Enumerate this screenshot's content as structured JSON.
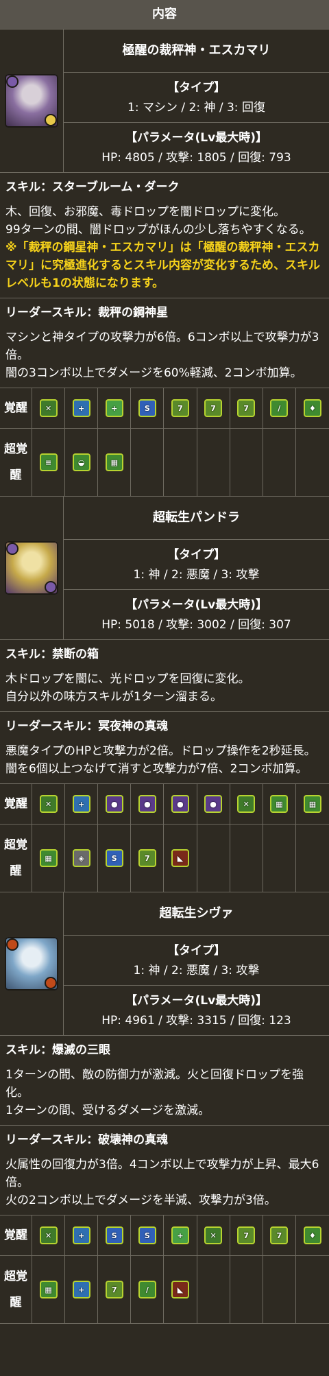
{
  "header": {
    "title": "内容"
  },
  "cards": [
    {
      "name": "極醒の裁秤神・エスカマリ",
      "portrait_colors": [
        "#8a6fa0",
        "#d8d0d8",
        "#3a2a46"
      ],
      "badge_colors": [
        "#7a5aa8",
        "#e7c84a"
      ],
      "type_label": "【タイプ】",
      "type_value": "1: マシン / 2: 神 / 3: 回復",
      "param_label": "【パラメータ(Lv最大時)】",
      "param_value": "HP: 4805 / 攻撃: 1805 / 回復: 793",
      "skill_title": "スキル：スターブルーム・ダーク",
      "skill_lines": [
        "木、回復、お邪魔、毒ドロップを闇ドロップに変化。",
        "99ターンの間、闇ドロップがほんの少し落ちやすくなる。"
      ],
      "skill_warn": "※「裁秤の鋼星神・エスカマリ」は「極醒の裁秤神・エスカマリ」に究極進化するとスキル内容が変化するため、スキルレベルも1の状態になります。",
      "leader_title": "リーダースキル：裁秤の鋼神星",
      "leader_lines": [
        "マシンと神タイプの攻撃力が6倍。6コンボ以上で攻撃力が3倍。",
        "闇の3コンボ以上でダメージを60%軽減、2コンボ加算。"
      ],
      "awaken_label": "覚醒",
      "awakenings": [
        {
          "icon": "cross-swords-icon",
          "glyph": "✕",
          "bg": "#3f7a2a"
        },
        {
          "icon": "plus-drop-icon",
          "glyph": "+",
          "bg": "#2f6fb0"
        },
        {
          "icon": "drop-enhance-icon",
          "glyph": "+",
          "bg": "#47a045"
        },
        {
          "icon": "bind-resist-icon",
          "glyph": "S",
          "bg": "#3060b8"
        },
        {
          "icon": "seven-combo-icon",
          "glyph": "7",
          "bg": "#5a8a2a"
        },
        {
          "icon": "seven-combo-icon",
          "glyph": "7",
          "bg": "#5a8a2a"
        },
        {
          "icon": "seven-combo-icon",
          "glyph": "7",
          "bg": "#5a8a2a"
        },
        {
          "icon": "wand-icon",
          "glyph": "/",
          "bg": "#3f8a30"
        },
        {
          "icon": "gem-wand-icon",
          "glyph": "♦",
          "bg": "#3f8a30"
        }
      ],
      "super_label_1": "超覚",
      "super_label_2": "醒",
      "super_awakenings": [
        {
          "icon": "scroll-icon",
          "glyph": "≡",
          "bg": "#3f8a30"
        },
        {
          "icon": "bowl-icon",
          "glyph": "◒",
          "bg": "#3f8a30"
        },
        {
          "icon": "jammer-grid-icon",
          "glyph": "▦",
          "bg": "#3f8a30"
        }
      ]
    },
    {
      "name": "超転生パンドラ",
      "portrait_colors": [
        "#c6a94a",
        "#efe1a4",
        "#4a2f6e"
      ],
      "badge_colors": [
        "#7a5aa8",
        "#7a5aa8"
      ],
      "type_label": "【タイプ】",
      "type_value": "1: 神 / 2: 悪魔 / 3: 攻撃",
      "param_label": "【パラメータ(Lv最大時)】",
      "param_value": "HP: 5018 / 攻撃: 3002 / 回復: 307",
      "skill_title": "スキル：禁断の箱",
      "skill_lines": [
        "木ドロップを闇に、光ドロップを回復に変化。",
        "自分以外の味方スキルが1ターン溜まる。"
      ],
      "skill_warn": "",
      "leader_title": "リーダースキル：冥夜神の真魂",
      "leader_lines": [
        "悪魔タイプのHPと攻撃力が2倍。ドロップ操作を2秒延長。",
        "闇を6個以上つなげて消すと攻撃力が7倍、2コンボ加算。"
      ],
      "awaken_label": "覚醒",
      "awakenings": [
        {
          "icon": "cross-swords-icon",
          "glyph": "✕",
          "bg": "#3f7a2a"
        },
        {
          "icon": "plus-drop-icon",
          "glyph": "+",
          "bg": "#2f6fb0"
        },
        {
          "icon": "dark-row-icon",
          "glyph": "●",
          "bg": "#5a3a8a"
        },
        {
          "icon": "dark-row-icon",
          "glyph": "●",
          "bg": "#5a3a8a"
        },
        {
          "icon": "dark-row-icon",
          "glyph": "●",
          "bg": "#5a3a8a"
        },
        {
          "icon": "dark-row-icon",
          "glyph": "●",
          "bg": "#5a3a8a"
        },
        {
          "icon": "cross-swords-icon",
          "glyph": "✕",
          "bg": "#3f7a2a"
        },
        {
          "icon": "jammer-grid-icon",
          "glyph": "▦",
          "bg": "#3f8a30"
        },
        {
          "icon": "jammer-grid-icon",
          "glyph": "▦",
          "bg": "#3f8a30"
        }
      ],
      "super_label_1": "超覚",
      "super_label_2": "醒",
      "super_awakenings": [
        {
          "icon": "jammer-grid-icon",
          "glyph": "▦",
          "bg": "#3f8a30"
        },
        {
          "icon": "shield-icon",
          "glyph": "◈",
          "bg": "#6a6a6a"
        },
        {
          "icon": "bind-resist-icon",
          "glyph": "S",
          "bg": "#3060b8"
        },
        {
          "icon": "seven-combo-icon",
          "glyph": "7",
          "bg": "#5a8a2a"
        },
        {
          "icon": "dark-block-icon",
          "glyph": "◣",
          "bg": "#7a2a1a"
        }
      ]
    },
    {
      "name": "超転生シヴァ",
      "portrait_colors": [
        "#7fa7c8",
        "#e6eef4",
        "#3a4f6a"
      ],
      "badge_colors": [
        "#c04a1a",
        "#c04a1a"
      ],
      "type_label": "【タイプ】",
      "type_value": "1: 神 / 2: 悪魔 / 3: 攻撃",
      "param_label": "【パラメータ(Lv最大時)】",
      "param_value": "HP: 4961 / 攻撃: 3315 / 回復: 123",
      "skill_title": "スキル：爆滅の三眼",
      "skill_lines": [
        "1ターンの間、敵の防御力が激減。火と回復ドロップを強化。",
        "1ターンの間、受けるダメージを激減。"
      ],
      "skill_warn": "",
      "leader_title": "リーダースキル：破壊神の真魂",
      "leader_lines": [
        "火属性の回復力が3倍。4コンボ以上で攻撃力が上昇、最大6倍。",
        "火の2コンボ以上でダメージを半減、攻撃力が3倍。"
      ],
      "awaken_label": "覚醒",
      "awakenings": [
        {
          "icon": "cross-swords-icon",
          "glyph": "✕",
          "bg": "#3f7a2a"
        },
        {
          "icon": "plus-drop-icon",
          "glyph": "+",
          "bg": "#2f6fb0"
        },
        {
          "icon": "bind-resist-icon",
          "glyph": "S",
          "bg": "#3060b8"
        },
        {
          "icon": "bind-resist-icon",
          "glyph": "S",
          "bg": "#3060b8"
        },
        {
          "icon": "drop-enhance-icon",
          "glyph": "+",
          "bg": "#47a045"
        },
        {
          "icon": "cross-swords-icon",
          "glyph": "✕",
          "bg": "#3f7a2a"
        },
        {
          "icon": "seven-combo-icon",
          "glyph": "7",
          "bg": "#5a8a2a"
        },
        {
          "icon": "seven-combo-icon",
          "glyph": "7",
          "bg": "#5a8a2a"
        },
        {
          "icon": "gem-wand-icon",
          "glyph": "♦",
          "bg": "#3f8a30"
        }
      ],
      "super_label_1": "超覚",
      "super_label_2": "醒",
      "super_awakenings": [
        {
          "icon": "jammer-grid-icon",
          "glyph": "▦",
          "bg": "#3f8a30"
        },
        {
          "icon": "plus-drop-icon",
          "glyph": "+",
          "bg": "#2f6fb0"
        },
        {
          "icon": "seven-combo-icon",
          "glyph": "7",
          "bg": "#5a8a2a"
        },
        {
          "icon": "wand-icon",
          "glyph": "/",
          "bg": "#3f8a30"
        },
        {
          "icon": "dark-block-icon",
          "glyph": "◣",
          "bg": "#7a2a1a"
        }
      ]
    }
  ]
}
